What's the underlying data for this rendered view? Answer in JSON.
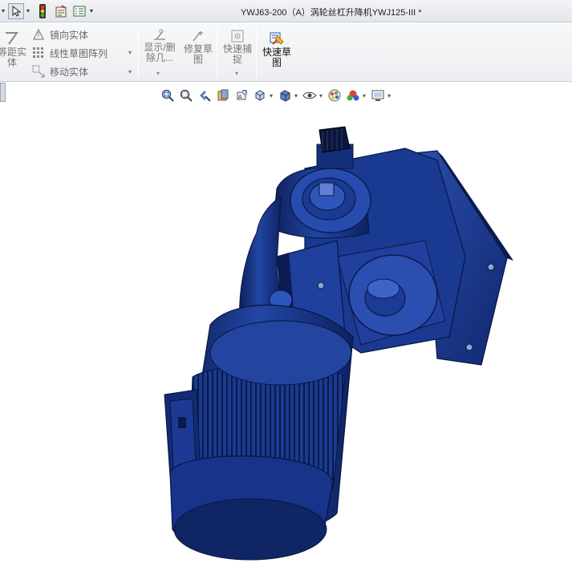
{
  "window": {
    "title": "YWJ63-200（A）涡轮丝杠升降机YWJ125-III *"
  },
  "ribbon": {
    "equidistant_entity_label": "等距实\n体",
    "mirror_entity_label": "镜向实体",
    "linear_pattern_label": "线性草图阵列",
    "move_entity_label": "移动实体",
    "show_delete_relations_label": "显示/删\n除几...",
    "repair_sketch_label": "修复草\n图",
    "quick_snaps_label": "快速捕\n捉",
    "rapid_sketch_label": "快速草\n图"
  },
  "colors": {
    "model_blue": "#1d3a8a",
    "model_dark": "#0b1e52",
    "accent_blue": "#2a66d0"
  },
  "icons": [
    "select-arrow-icon",
    "traffic-light-icon",
    "file-properties-icon",
    "options-icon",
    "zoom-to-fit-icon",
    "zoom-area-icon",
    "previous-view-icon",
    "section-view-icon",
    "dynamic-annotation-icon",
    "view-orientation-icon",
    "display-style-icon",
    "hide-show-items-icon",
    "edit-appearance-icon",
    "apply-scene-icon",
    "view-settings-icon"
  ]
}
